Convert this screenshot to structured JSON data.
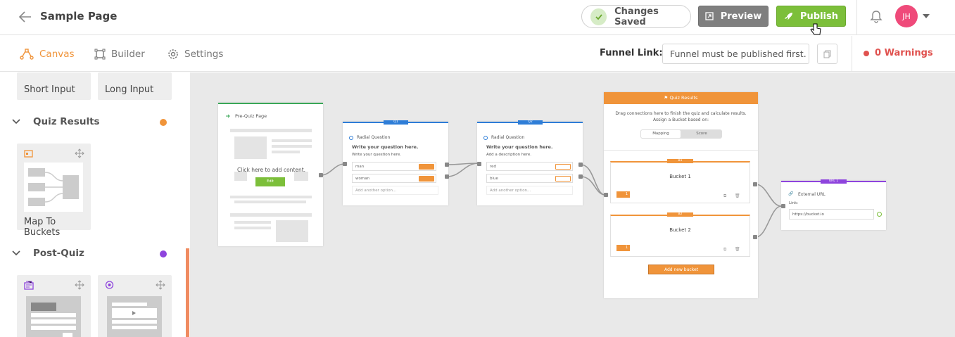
{
  "header": {
    "title": "Sample Page",
    "saved_status": "Changes Saved",
    "preview_label": "Preview",
    "publish_label": "Publish",
    "avatar_initials": "JH"
  },
  "tabs": [
    {
      "label": "Canvas",
      "active": true
    },
    {
      "label": "Builder",
      "active": false
    },
    {
      "label": "Settings",
      "active": false
    }
  ],
  "funnel": {
    "label": "Funnel Link:",
    "value": "Funnel must be published first.",
    "warnings": "0 Warnings"
  },
  "sidebar": {
    "top_items": [
      "Short Input",
      "Long Input"
    ],
    "quiz_results": {
      "title": "Quiz Results",
      "item": "Map To Buckets",
      "dot_color": "#f0943a"
    },
    "post_quiz": {
      "title": "Post-Quiz",
      "dot_color": "#8e44dd"
    }
  },
  "canvas": {
    "prequiz": {
      "title": "Pre-Quiz Page",
      "placeholder": "Click here to add content.",
      "edit_label": "Edit"
    },
    "q1": {
      "tag": "Q1",
      "type": "Radial Question",
      "question": "Write your question here.",
      "description": "Write your question here.",
      "options": [
        "man",
        "woman"
      ],
      "add_option": "Add another option..."
    },
    "q2": {
      "tag": "Q2",
      "type": "Radial Question",
      "question": "Write your question here.",
      "description": "Add a description here.",
      "options": [
        "red",
        "blue"
      ],
      "add_option": "Add another option..."
    },
    "results": {
      "title": "Quiz Results",
      "desc1": "Drag connections here to finish the quiz and calculate results.",
      "desc2": "Assign a Bucket based on:",
      "toggle": [
        "Mapping",
        "Score"
      ],
      "buckets": [
        {
          "tag": "B1",
          "name": "Bucket 1",
          "count": "1"
        },
        {
          "tag": "B2",
          "name": "Bucket 2",
          "count": "1"
        }
      ],
      "add_bucket": "Add new bucket"
    },
    "url": {
      "tag": "URL 1",
      "title": "External URL",
      "link_label": "Link:",
      "link_value": "https://bucket.io"
    }
  },
  "colors": {
    "orange": "#f0943a",
    "green": "#7cbf3a",
    "purple": "#8e44dd",
    "blue": "#2e7dd7",
    "warning": "#e0524f"
  }
}
